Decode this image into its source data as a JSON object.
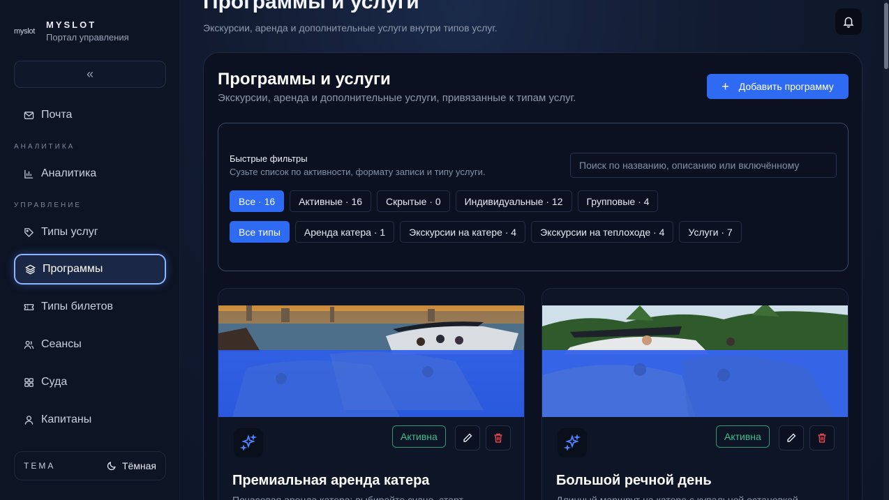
{
  "brand": {
    "logo_text": "myslot",
    "name": "MYSLOT",
    "subtitle": "Портал управления"
  },
  "sidebar": {
    "collapse_label": "«",
    "mail": "Почта",
    "section_analytics": "АНАЛИТИКА",
    "analytics": "Аналитика",
    "section_management": "УПРАВЛЕНИЕ",
    "service_types": "Типы услуг",
    "programs": "Программы",
    "ticket_types": "Типы билетов",
    "sessions": "Сеансы",
    "vessels": "Суда",
    "captains": "Капитаны",
    "theme_label": "ТЕМА",
    "theme_value": "Тёмная"
  },
  "header": {
    "title": "Программы и услуги",
    "subtitle": "Экскурсии, аренда и дополнительные услуги внутри типов услуг."
  },
  "panel": {
    "title": "Программы и услуги",
    "subtitle": "Экскурсии, аренда и дополнительные услуги, привязанные к типам услуг.",
    "add_button": "Добавить программу"
  },
  "filters": {
    "title": "Быстрые фильтры",
    "subtitle": "Сузьте список по активности, формату записи и типу услуги.",
    "search_placeholder": "Поиск по названию, описанию или включённому",
    "status_chips": [
      "Все · 16",
      "Активные · 16",
      "Скрытые · 0",
      "Индивидуальные · 12",
      "Групповые · 4"
    ],
    "type_chips": [
      "Все типы",
      "Аренда катера · 1",
      "Экскурсии на катере · 4",
      "Экскурсии на теплоходе · 4",
      "Услуги · 7"
    ],
    "active_status_index": 0,
    "active_type_index": 0
  },
  "cards": [
    {
      "status": "Активна",
      "title": "Премиальная аренда катера",
      "description": "Почасовая аренда катера: выбирайте судно, старт"
    },
    {
      "status": "Активна",
      "title": "Большой речной день",
      "description": "Длинный маршрут на катере с купальной остановкой"
    }
  ],
  "colors": {
    "accent": "#2f6bf2",
    "status_active": "#3fbf8a",
    "delete": "#e0444e"
  }
}
